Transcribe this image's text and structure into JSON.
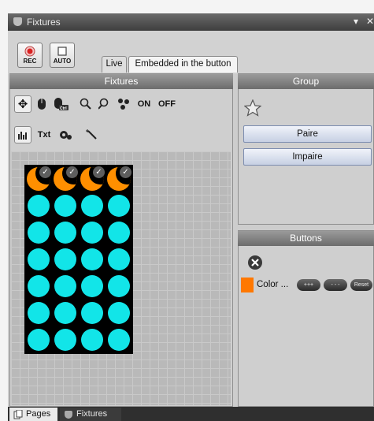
{
  "window": {
    "title": "Fixtures",
    "pin_glyph": "▾",
    "close_glyph": "✕"
  },
  "toolbar": {
    "rec_label": "REC",
    "auto_label": "AUTO"
  },
  "tabs": [
    {
      "label": "Live"
    },
    {
      "label": "Embedded in the button"
    }
  ],
  "fixtures": {
    "title": "Fixtures",
    "tools_row1": [
      {
        "name": "move-icon",
        "glyph": "✥"
      },
      {
        "name": "mouse-icon",
        "glyph": ""
      },
      {
        "name": "mouse-ctrl-icon",
        "glyph": "Ctrl"
      },
      {
        "name": "zoom-in-icon",
        "glyph": ""
      },
      {
        "name": "zoom-out-icon",
        "glyph": ""
      },
      {
        "name": "group-dots-icon",
        "glyph": ""
      },
      {
        "name": "on-button",
        "text": "ON"
      },
      {
        "name": "off-button",
        "text": "OFF"
      }
    ],
    "tools_row2": [
      {
        "name": "level-bars-icon",
        "active": true
      },
      {
        "name": "txt-button",
        "text": "Txt"
      },
      {
        "name": "settings-gear-icon"
      },
      {
        "name": "magic-wand-icon"
      }
    ],
    "grid": {
      "rows": 7,
      "cols": 4,
      "top_row_type": "selected-orange",
      "other_type": "cyan",
      "colors": {
        "cyan": "#12e5e8",
        "orange": "#ff8f00"
      }
    }
  },
  "group": {
    "title": "Group",
    "star_icon": "star-icon",
    "buttons": [
      {
        "label": "Paire"
      },
      {
        "label": "Impaire"
      }
    ]
  },
  "buttons_panel": {
    "title": "Buttons",
    "delete_icon": "close-circle-icon",
    "item": {
      "label": "Color ...",
      "color": "#ff7800",
      "pills": [
        "+++",
        "- - -",
        "Reset"
      ]
    }
  },
  "status": {
    "tabs": [
      {
        "label": "Pages"
      },
      {
        "label": "Fixtures"
      }
    ]
  }
}
